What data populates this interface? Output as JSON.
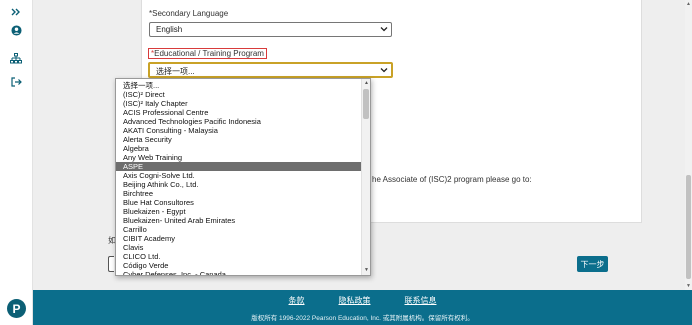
{
  "sidebar": {
    "icons": [
      "chevrons-right-icon",
      "user-circle-icon",
      "sitemap-icon",
      "sign-out-icon"
    ],
    "logo": "P"
  },
  "form": {
    "secondary_language_label": "*Secondary Language",
    "secondary_language_value": "English",
    "program_label_prefix": "*",
    "program_label": "Educational / Training Program",
    "program_value": "选择一项..."
  },
  "dropdown": {
    "selected_index": 9,
    "options": [
      "选择一项...",
      "(ISC)² Direct",
      "(ISC)² Italy Chapter",
      "ACIS Professional Centre",
      "Advanced Technologies Pacific Indonesia",
      "AKATI Consulting - Malaysia",
      "Alerta Security",
      "Algebra",
      "Any Web Training",
      "ASPE",
      "Axis Cogni-Solve Ltd.",
      "Beijing Athink Co., Ltd.",
      "Birchtree",
      "Blue Hat Consultores",
      "Bluekaizen - Egypt",
      "Bluekaizen- United Arab Emirates",
      "Carrillo",
      "CIBIT Academy",
      "Clavis",
      "CLICO Ltd.",
      "Código Verde",
      "Cyber Defenses, Inc. - Canada"
    ]
  },
  "content": {
    "associate_text": "he Associate of (ISC)2 program please go to:",
    "partial_left_text": "如"
  },
  "buttons": {
    "next_label": "下一步"
  },
  "footer": {
    "links": [
      "条款",
      "隐私政策",
      "联系信息"
    ],
    "copyright": "版权所有 1996-2022 Pearson Education, Inc. 或其附属机构。保留所有权利。"
  },
  "colors": {
    "brand": "#0b6e8c",
    "selected_option": "#6e6e6e",
    "label_highlight": "#d83b3b",
    "focus_ring": "#c9a227"
  }
}
